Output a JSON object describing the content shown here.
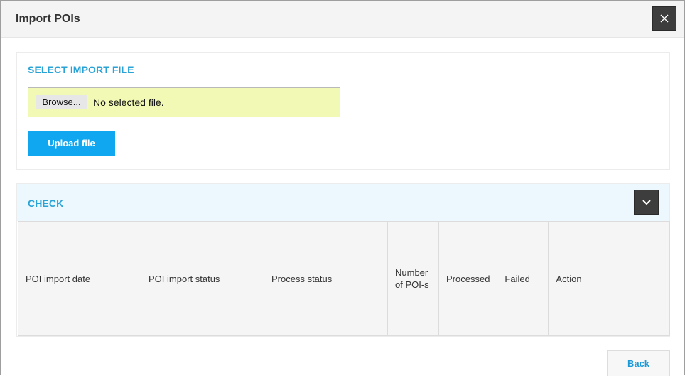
{
  "dialog": {
    "title": "Import POIs",
    "close_icon": "close-icon"
  },
  "import_section": {
    "title": "SELECT IMPORT FILE",
    "browse_label": "Browse...",
    "file_status": "No selected file.",
    "upload_label": "Upload file"
  },
  "check_section": {
    "title": "CHECK",
    "toggle_icon": "chevron-down-icon",
    "columns": [
      "POI import date",
      "POI import status",
      "Process status",
      "Number of POI-s",
      "Processed",
      "Failed",
      "Action"
    ]
  },
  "footer": {
    "back_label": "Back"
  },
  "colors": {
    "accent": "#10a7f0",
    "section_title": "#29a3d6",
    "file_box_bg": "#f2f9b4",
    "dark_button": "#3d3d3d"
  }
}
